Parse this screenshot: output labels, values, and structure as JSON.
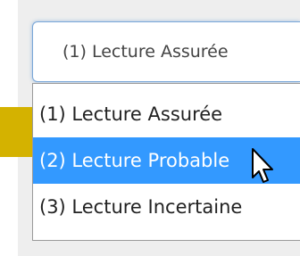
{
  "select": {
    "current_value": "(1) Lecture Assurée",
    "options": [
      {
        "label": "(1) Lecture Assurée",
        "highlighted": false
      },
      {
        "label": "(2) Lecture Probable",
        "highlighted": true
      },
      {
        "label": "(3) Lecture Incertaine",
        "highlighted": false
      }
    ]
  },
  "colors": {
    "highlight": "#3399ff",
    "accent_band": "#d4b200",
    "focus_border": "#7aa7d8"
  },
  "icons": {
    "cursor": "mouse-pointer-icon"
  }
}
